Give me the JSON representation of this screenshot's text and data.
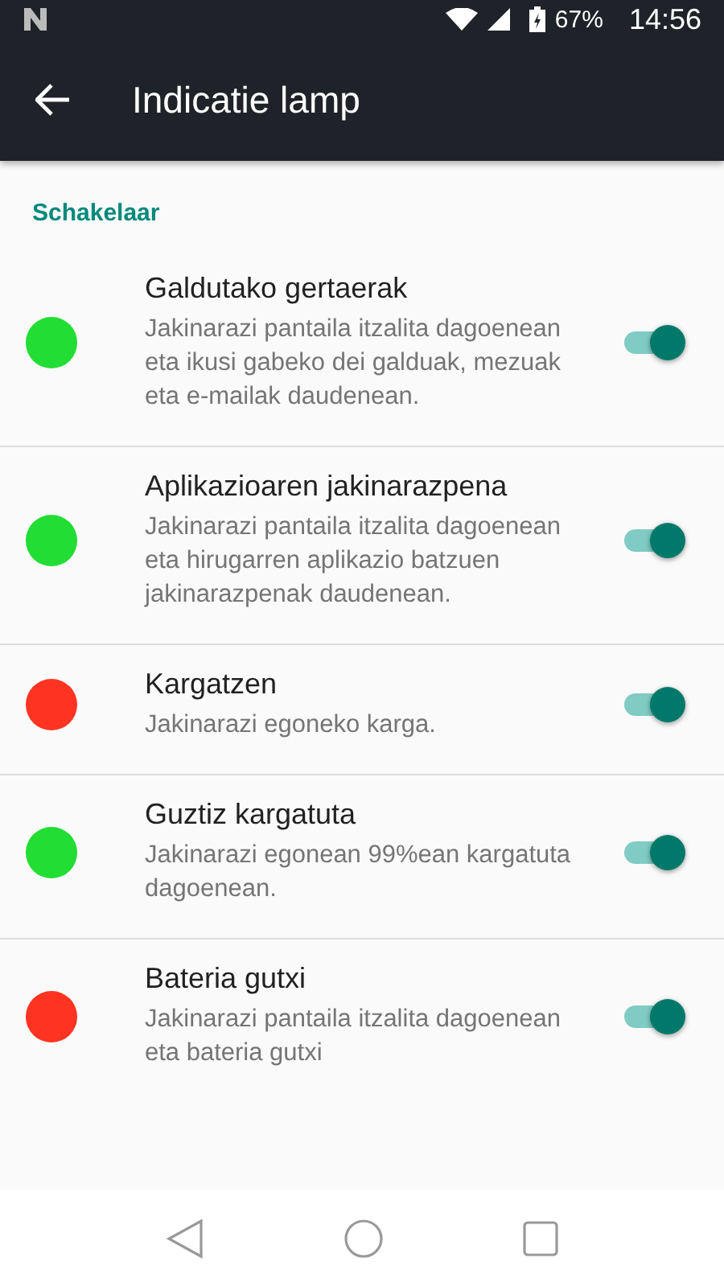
{
  "status_bar": {
    "battery": "67%",
    "time": "14:56"
  },
  "toolbar": {
    "title": "Indicatie lamp"
  },
  "section": {
    "title": "Schakelaar"
  },
  "items": [
    {
      "title": "Galdutako gertaerak",
      "description": "Jakinarazi pantaila itzalita dagoenean eta ikusi gabeko dei galduak, mezuak eta e-mailak daudenean.",
      "color": "#22dd33",
      "on": true
    },
    {
      "title": "Aplikazioaren jakinarazpena",
      "description": "Jakinarazi pantaila itzalita dagoenean eta hirugarren aplikazio batzuen jakinarazpenak daudenean.",
      "color": "#22dd33",
      "on": true
    },
    {
      "title": "Kargatzen",
      "description": "Jakinarazi egoneko karga.",
      "color": "#ff3322",
      "on": true
    },
    {
      "title": "Guztiz kargatuta",
      "description": "Jakinarazi egonean 99%ean kargatuta dagoenean.",
      "color": "#22dd33",
      "on": true
    },
    {
      "title": "Bateria gutxi",
      "description": "Jakinarazi pantaila itzalita dagoenean eta bateria gutxi",
      "color": "#ff3322",
      "on": true
    }
  ]
}
